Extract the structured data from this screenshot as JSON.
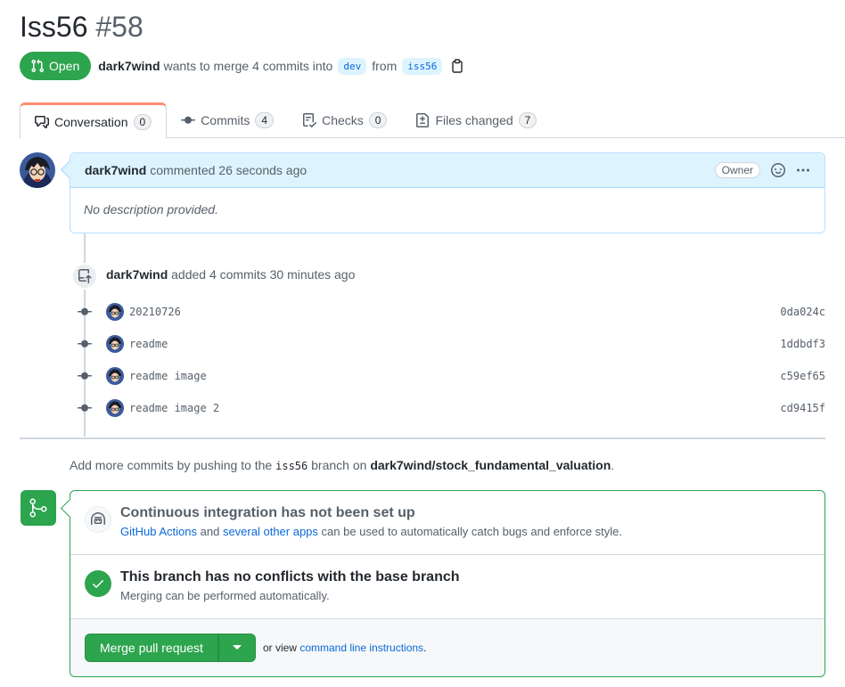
{
  "pr": {
    "title": "Iss56",
    "number": "#58",
    "state": "Open",
    "author": "dark7wind",
    "merge_text": "wants to merge 4 commits into",
    "base_branch": "dev",
    "from_text": "from",
    "head_branch": "iss56"
  },
  "tabs": [
    {
      "label": "Conversation",
      "count": "0"
    },
    {
      "label": "Commits",
      "count": "4"
    },
    {
      "label": "Checks",
      "count": "0"
    },
    {
      "label": "Files changed",
      "count": "7"
    }
  ],
  "comment": {
    "author": "dark7wind",
    "action": "commented 26 seconds ago",
    "role": "Owner",
    "body": "No description provided."
  },
  "event": {
    "author": "dark7wind",
    "text": "added 4 commits 30 minutes ago"
  },
  "commits": [
    {
      "message": "20210726",
      "sha": "0da024c"
    },
    {
      "message": "readme",
      "sha": "1ddbdf3"
    },
    {
      "message": "readme image",
      "sha": "c59ef65"
    },
    {
      "message": "readme image 2",
      "sha": "cd9415f"
    }
  ],
  "hint": {
    "prefix": "Add more commits by pushing to the",
    "branch": "iss56",
    "middle": "branch on",
    "repo": "dark7wind/stock_fundamental_valuation",
    "suffix": "."
  },
  "merge": {
    "ci_title": "Continuous integration has not been set up",
    "ci_link1": "GitHub Actions",
    "ci_and": "and",
    "ci_link2": "several other apps",
    "ci_rest": "can be used to automatically catch bugs and enforce style.",
    "conflict_title": "This branch has no conflicts with the base branch",
    "conflict_sub": "Merging can be performed automatically.",
    "button": "Merge pull request",
    "or_view": "or view",
    "cli_link": "command line instructions",
    "cli_suffix": "."
  },
  "colors": {
    "open_green": "#2da44e",
    "link_blue": "#0969da",
    "tab_accent": "#fd8c73"
  }
}
